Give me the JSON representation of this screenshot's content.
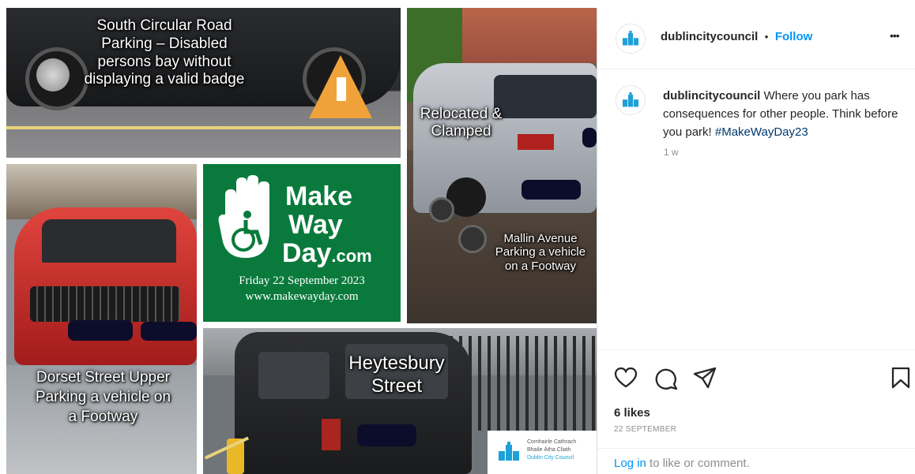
{
  "header": {
    "username": "dublincitycouncil",
    "dot": "•",
    "follow_label": "Follow",
    "more_label": "•••"
  },
  "caption": {
    "username": "dublincitycouncil",
    "text": " Where you park has consequences for other people. Think before you park! ",
    "hashtag": "#MakeWayDay23",
    "time": "1 w"
  },
  "stats": {
    "likes": "6 likes",
    "date": "22 SEPTEMBER"
  },
  "footer": {
    "login_link": "Log in",
    "login_rest": " to like or comment."
  },
  "tiles": {
    "south_circular": "South Circular Road Parking – Disabled persons bay without displaying a valid badge",
    "relocated": "Relocated & Clamped",
    "mallin": "Mallin Avenue Parking a vehicle on a Footway",
    "dorset": "Dorset Street Upper Parking a vehicle on a Footway",
    "heytesbury": "Heytesbury Street",
    "makeway_line1": "Make",
    "makeway_line2": "Way",
    "makeway_line3": "Day",
    "makeway_dotcom": ".com",
    "makeway_date": "Friday 22 September 2023",
    "makeway_url": "www.makewayday.com",
    "council_line1": "Comhairle Cathrach",
    "council_line2": "Bhaile Átha Cliath",
    "council_line3": "Dublin City Council"
  },
  "colors": {
    "makeway_green": "#0a7a3c",
    "follow_blue": "#0095f6",
    "hashtag_blue": "#00376b"
  },
  "icons": [
    "heart-icon",
    "comment-icon",
    "share-icon",
    "bookmark-icon",
    "castle-logo-icon"
  ]
}
